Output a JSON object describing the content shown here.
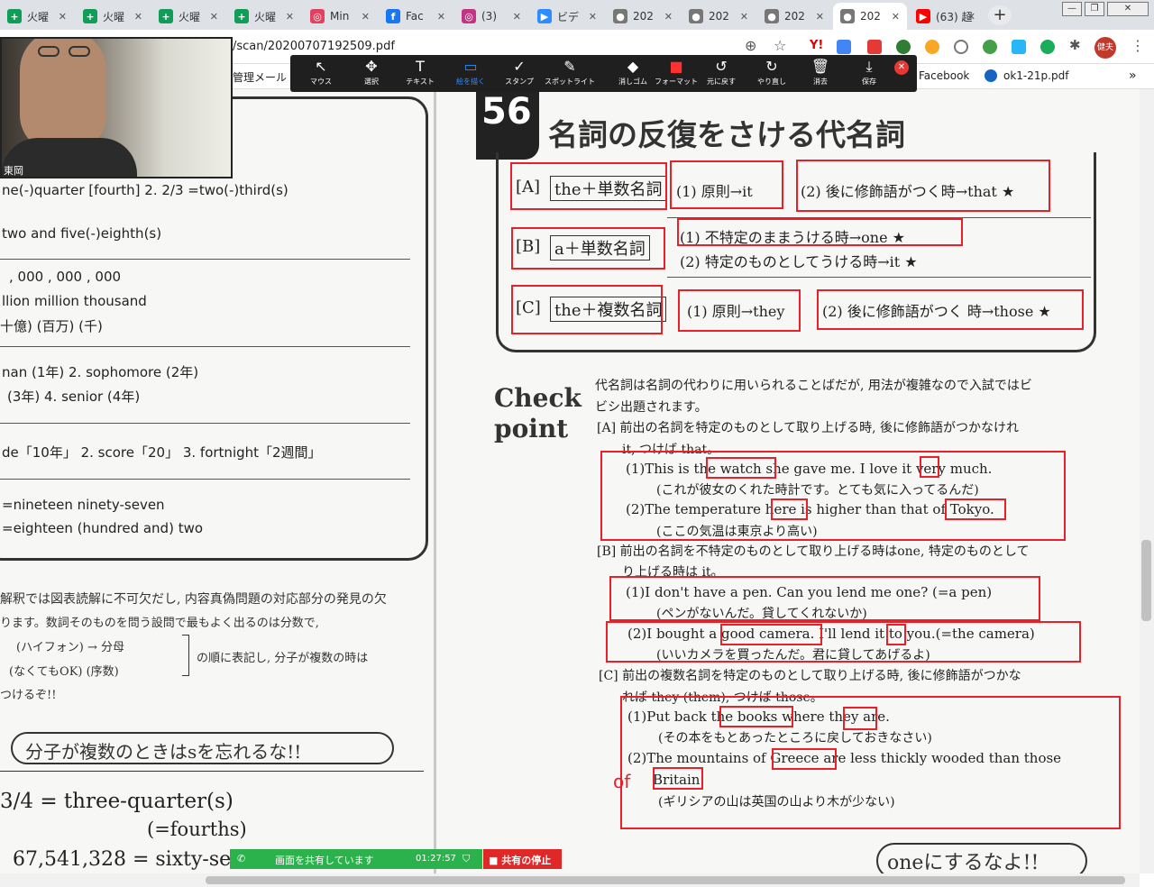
{
  "tabs": [
    {
      "title": "火曜",
      "icon": "+",
      "color": "#0f9d58"
    },
    {
      "title": "火曜",
      "icon": "+",
      "color": "#0f9d58"
    },
    {
      "title": "火曜",
      "icon": "+",
      "color": "#0f9d58"
    },
    {
      "title": "火曜",
      "icon": "+",
      "color": "#0f9d58"
    },
    {
      "title": "Min",
      "icon": "◎",
      "color": "#e4405f"
    },
    {
      "title": "Fac",
      "icon": "f",
      "color": "#1877f2"
    },
    {
      "title": "(3)",
      "icon": "◎",
      "color": "#c13584"
    },
    {
      "title": "ビデ",
      "icon": "▶",
      "color": "#2d8cff"
    },
    {
      "title": "202",
      "icon": "●",
      "color": "#777777"
    },
    {
      "title": "202",
      "icon": "●",
      "color": "#777777"
    },
    {
      "title": "202",
      "icon": "●",
      "color": "#777777"
    },
    {
      "title": "202",
      "icon": "●",
      "color": "#777777"
    },
    {
      "title": "(63) 超",
      "icon": "▶",
      "color": "#ff0000"
    }
  ],
  "address": {
    "url": "/scan/20200707192509.pdf"
  },
  "bookmarks": {
    "left": "管理メール",
    "facebook": "Facebook",
    "pdf": "ok1-21p.pdf"
  },
  "profile": {
    "name": "健夫"
  },
  "toolbar": [
    {
      "glyph": "↖",
      "label": "マウス"
    },
    {
      "glyph": "✥",
      "label": "選択"
    },
    {
      "glyph": "T",
      "label": "テキスト"
    },
    {
      "glyph": "▭",
      "label": "絵を描く"
    },
    {
      "glyph": "✓",
      "label": "スタンプ"
    },
    {
      "glyph": "✎",
      "label": "スポットライト"
    },
    {
      "glyph": "◆",
      "label": "消しゴム"
    },
    {
      "glyph": "■",
      "label": "フォーマット"
    },
    {
      "glyph": "↺",
      "label": "元に戻す"
    },
    {
      "glyph": "↻",
      "label": "やり直し"
    },
    {
      "glyph": "🗑",
      "label": "消去"
    },
    {
      "glyph": "⤓",
      "label": "保存"
    }
  ],
  "camera": {
    "name": "東岡"
  },
  "left_page": {
    "line1": "ne(-)quarter [fourth]    2. 2/3 =two(-)third(s)",
    "line2": "two and five(-)eighth(s)",
    "line3": ",  000  ,  000  ,  000",
    "line4": "llion    million   thousand",
    "line5": "十億)  (百万)  (千)",
    "line6": "nan (1年)      2. sophomore (2年)",
    "line7": "(3年)          4. senior (4年)",
    "line8": "de「10年」    2. score「20」    3. fortnight「2週間」",
    "line9": "=nineteen ninety-seven",
    "line10": "=eighteen (hundred and) two",
    "hw1": "解釈では図表読解に不可欠だし, 内容真偽問題の対応部分の発見の欠",
    "hw2": "ります。数詞そのものを問う設問で最もよく出るのは分数で,",
    "hw3": "(ハイフォン)  →  分母",
    "hw4": "(なくてもOK)     (序数)",
    "hw5": "の順に表記し, 分子が複数の時は",
    "hw6": "つけるぞ!!",
    "bubble": "分子が複数のときはsを忘れるな!!",
    "big1": "3/4 = three-quarter(s)",
    "big2": "(=fourths)",
    "big3": "67,541,328 = sixty-se"
  },
  "right_page": {
    "number": "56",
    "title": "名詞の反復をさける代名詞",
    "a_label": "[A]",
    "a_box": "the＋単数名詞",
    "a1": "(1) 原則→it",
    "a2": "(2) 後に修飾語がつく時→that ★",
    "b_label": "[B]",
    "b_box": "a＋単数名詞",
    "b1": "(1) 不特定のままうける時→one ★",
    "b2": "(2) 特定のものとしてうける時→it ★",
    "c_label": "[C]",
    "c_box": "the＋複数名詞",
    "c1": "(1) 原則→they",
    "c2": "(2) 後に修飾語がつく 時→those ★",
    "check": "Check",
    "point": "point",
    "intro1": "代名詞は名詞の代わりに用いられることばだが, 用法が複雑なので入試ではビ",
    "intro2": "ビシ出題されます。",
    "sa1": "[A]  前出の名詞を特定のものとして取り上げる時, 後に修飾語がつかなけれ",
    "sa2": "it, つけば that。",
    "ea1": "(1)This is the watch she gave me. I love it very much.",
    "ja1": "(これが彼女のくれた時計です。とても気に入ってるんだ)",
    "ea2": "(2)The temperature here is higher than that of Tokyo.",
    "ja2": "(ここの気温は東京より高い)",
    "sb1": "[B] 前出の名詞を不特定のものとして取り上げる時はone, 特定のものとして",
    "sb2": "り上げる時は it。",
    "eb1": "(1)I don't have a pen. Can you lend me one?  (=a pen)",
    "jb1": "(ペンがないんだ。貸してくれないか)",
    "eb2": "(2)I bought a good camera. I'll lend it to you.(=the camera)",
    "jb2": "(いいカメラを買ったんだ。君に貸してあげるよ)",
    "sc1": "[C]  前出の複数名詞を特定のものとして取り上げる時, 後に修飾語がつかな",
    "sc2": "れば they (them), つけば those。",
    "ec1": "(1)Put back the books where they are.",
    "jc1": "(その本をもとあったところに戻しておきなさい)",
    "ec2": "(2)The mountains of Greece are less thickly wooded than those",
    "ec3": "Britain.",
    "jc2": "(ギリシアの山は英国の山より木が少ない)",
    "of_mark": "of",
    "bottom": "oneにするなよ!!"
  },
  "share": {
    "label": "画面を共有しています",
    "time": "01:27:57",
    "stop": "■ 共有の停止"
  }
}
